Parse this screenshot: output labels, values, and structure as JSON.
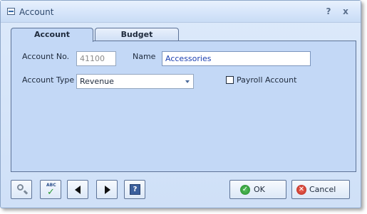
{
  "window": {
    "title": "Account",
    "help_glyph": "?",
    "close_glyph": "x"
  },
  "tabs": [
    {
      "label": "Account",
      "selected": true
    },
    {
      "label": "Budget",
      "selected": false
    }
  ],
  "form": {
    "account_no_label": "Account No.",
    "account_no_value": "41100",
    "name_label": "Name",
    "name_value": "Accessories",
    "account_type_label": "Account Type",
    "account_type_value": "Revenue",
    "payroll_label": "Payroll Account",
    "payroll_checked": false
  },
  "toolbar": {
    "icons": [
      "search-icon",
      "spell-check-icon",
      "previous-icon",
      "next-icon",
      "help-icon"
    ],
    "spell_glyph_text": "ABC",
    "help_glyph": "?",
    "ok_label": "OK",
    "cancel_label": "Cancel"
  },
  "colors": {
    "panel_bg": "#c3d8f6",
    "name_text": "#1b3fb0",
    "ok_green": "#238a2c",
    "cancel_red": "#b8261c"
  }
}
